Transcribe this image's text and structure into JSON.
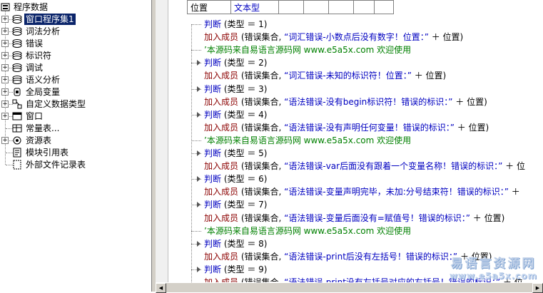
{
  "tree": {
    "root": "程序数据",
    "items": [
      {
        "label": "窗口程序集1",
        "icon": "folder-pages-icon",
        "expander": "+",
        "selected": true
      },
      {
        "label": "词法分析",
        "icon": "folder-pages-icon",
        "expander": "+"
      },
      {
        "label": "错误",
        "icon": "folder-pages-icon",
        "expander": "+"
      },
      {
        "label": "标识符",
        "icon": "folder-pages-icon",
        "expander": "+"
      },
      {
        "label": "调试",
        "icon": "folder-pages-icon",
        "expander": "+"
      },
      {
        "label": "语义分析",
        "icon": "folder-pages-icon",
        "expander": "+"
      },
      {
        "label": "全局变量",
        "icon": "database-icon",
        "expander": "+"
      },
      {
        "label": "自定义数据类型",
        "icon": "data-type-icon",
        "expander": "+"
      },
      {
        "label": "窗口",
        "icon": "window-icon",
        "expander": "+"
      },
      {
        "label": "常量表...",
        "icon": "constant-icon",
        "expander": ""
      },
      {
        "label": "资源表",
        "icon": "resource-icon",
        "expander": "+"
      },
      {
        "label": "模块引用表",
        "icon": "module-icon",
        "expander": ""
      },
      {
        "label": "外部文件记录表",
        "icon": "file-icon",
        "expander": ""
      }
    ]
  },
  "vars_table": {
    "row": [
      "位置",
      "文本型",
      "",
      "",
      "",
      "",
      ""
    ]
  },
  "code_lines": [
    {
      "indent": 1,
      "type": "if",
      "kw": "判断",
      "rest": " (类型 ＝ 1)",
      "arrow": false
    },
    {
      "indent": 2,
      "type": "cmd",
      "kw": "加入成员",
      "pre": " (错误集合, ",
      "str": "“词汇错误-小数点后没有数字！位置：”",
      "post": " ＋ 位置)"
    },
    {
      "indent": 1,
      "type": "cmt",
      "text": "’本源码来自易语言源码网 www.e5a5x.com  欢迎使用"
    },
    {
      "indent": 1,
      "type": "if",
      "kw": "判断",
      "rest": " (类型 ＝ 2)",
      "arrow": true
    },
    {
      "indent": 2,
      "type": "cmd",
      "kw": "加入成员",
      "pre": " (错误集合, ",
      "str": "“词汇错误-未知的标识符！位置：”",
      "post": " ＋ 位置)"
    },
    {
      "indent": 1,
      "type": "if",
      "kw": "判断",
      "rest": " (类型 ＝ 3)",
      "arrow": true
    },
    {
      "indent": 2,
      "type": "cmd",
      "kw": "加入成员",
      "pre": " (错误集合, ",
      "str": "“语法错误-没有begin标识符！错误的标识：”",
      "post": " ＋ 位置)"
    },
    {
      "indent": 1,
      "type": "if",
      "kw": "判断",
      "rest": " (类型 ＝ 4)",
      "arrow": true
    },
    {
      "indent": 2,
      "type": "cmd",
      "kw": "加入成员",
      "pre": " (错误集合, ",
      "str": "“语法错误-没有声明任何变量！错误的标识：”",
      "post": " ＋ 位置)"
    },
    {
      "indent": 1,
      "type": "cmt",
      "text": "’本源码来自易语言源码网 www.e5a5x.com  欢迎使用"
    },
    {
      "indent": 1,
      "type": "if",
      "kw": "判断",
      "rest": " (类型 ＝ 5)",
      "arrow": true
    },
    {
      "indent": 2,
      "type": "cmd",
      "kw": "加入成员",
      "pre": " (错误集合, ",
      "str": "“语法错误-var后面没有跟着一个变量名称！错误的标识：”",
      "post": " ＋ 位"
    },
    {
      "indent": 1,
      "type": "if",
      "kw": "判断",
      "rest": " (类型 ＝ 6)",
      "arrow": true
    },
    {
      "indent": 2,
      "type": "cmd",
      "kw": "加入成员",
      "pre": " (错误集合, ",
      "str": "“语法错误-变量声明完毕，未加:分号结束符！错误的标识：”",
      "post": " ＋"
    },
    {
      "indent": 1,
      "type": "if",
      "kw": "判断",
      "rest": " (类型 ＝ 7)",
      "arrow": true
    },
    {
      "indent": 2,
      "type": "cmd",
      "kw": "加入成员",
      "pre": " (错误集合, ",
      "str": "“语法错误-变量后面没有=赋值号！错误的标识：”",
      "post": " ＋ 位置)"
    },
    {
      "indent": 1,
      "type": "cmt",
      "text": "’本源码来自易语言源码网 www.e5a5x.com  欢迎使用"
    },
    {
      "indent": 1,
      "type": "if",
      "kw": "判断",
      "rest": " (类型 ＝ 8)",
      "arrow": true
    },
    {
      "indent": 2,
      "type": "cmd",
      "kw": "加入成员",
      "pre": " (错误集合, ",
      "str": "“语法错误-print后没有左括号！错误的标识：”",
      "post": " ＋ 位置)"
    },
    {
      "indent": 1,
      "type": "if",
      "kw": "判断",
      "rest": " (类型 ＝ 9)",
      "arrow": true
    },
    {
      "indent": 2,
      "type": "cmd",
      "kw": "加入成员",
      "pre": " (错误集合, ",
      "str": "“语法错误-print没有左括号对应的右括号！错误的标识：”",
      "post": " ＋ 位"
    }
  ],
  "watermark": {
    "line1": "易语言资源网",
    "line2": "www.e5a5x.com"
  },
  "colors": {
    "selection": "#0a246a",
    "keyword": "#0000c0",
    "command": "#8b0000",
    "comment": "#008000"
  }
}
